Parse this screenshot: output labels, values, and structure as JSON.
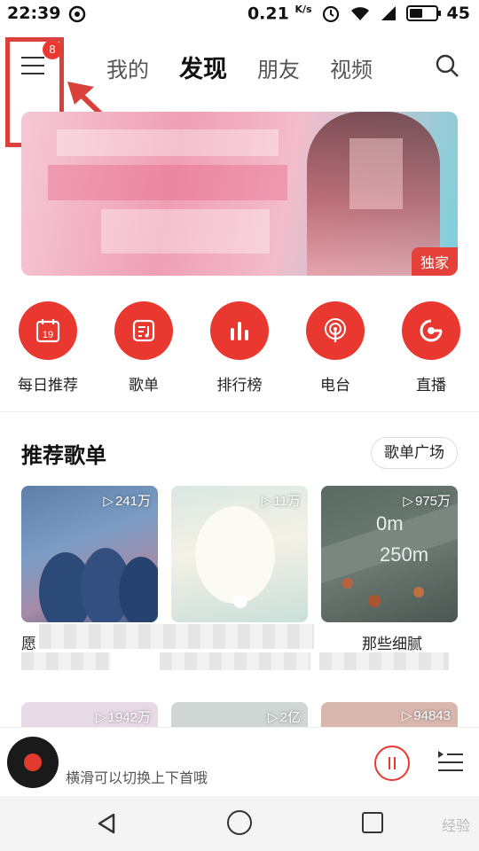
{
  "status": {
    "time": "22:39",
    "net_speed": "0.21",
    "net_unit": "K/s",
    "battery": "45"
  },
  "header": {
    "badge_count": "8",
    "tabs": [
      "我的",
      "发现",
      "朋友",
      "视频"
    ],
    "active_tab": "发现"
  },
  "banner": {
    "tag": "独家"
  },
  "quick_entries": [
    {
      "label": "每日推荐",
      "icon": "calendar-icon",
      "date": "19"
    },
    {
      "label": "歌单",
      "icon": "playlist-icon"
    },
    {
      "label": "排行榜",
      "icon": "chart-bars-icon"
    },
    {
      "label": "电台",
      "icon": "radio-icon"
    },
    {
      "label": "直播",
      "icon": "live-icon"
    }
  ],
  "section": {
    "title": "推荐歌单",
    "more_label": "歌单广场"
  },
  "playlists": [
    {
      "count": "241万",
      "title": "愿"
    },
    {
      "count": "11万",
      "title": ""
    },
    {
      "count": "975万",
      "title": "那些细腻"
    },
    {
      "count": "1942万",
      "title": ""
    },
    {
      "count": "2亿",
      "title": ""
    },
    {
      "count": "94843",
      "title": ""
    }
  ],
  "player": {
    "hint": "横滑可以切换上下首哦"
  },
  "watermark": "经验"
}
